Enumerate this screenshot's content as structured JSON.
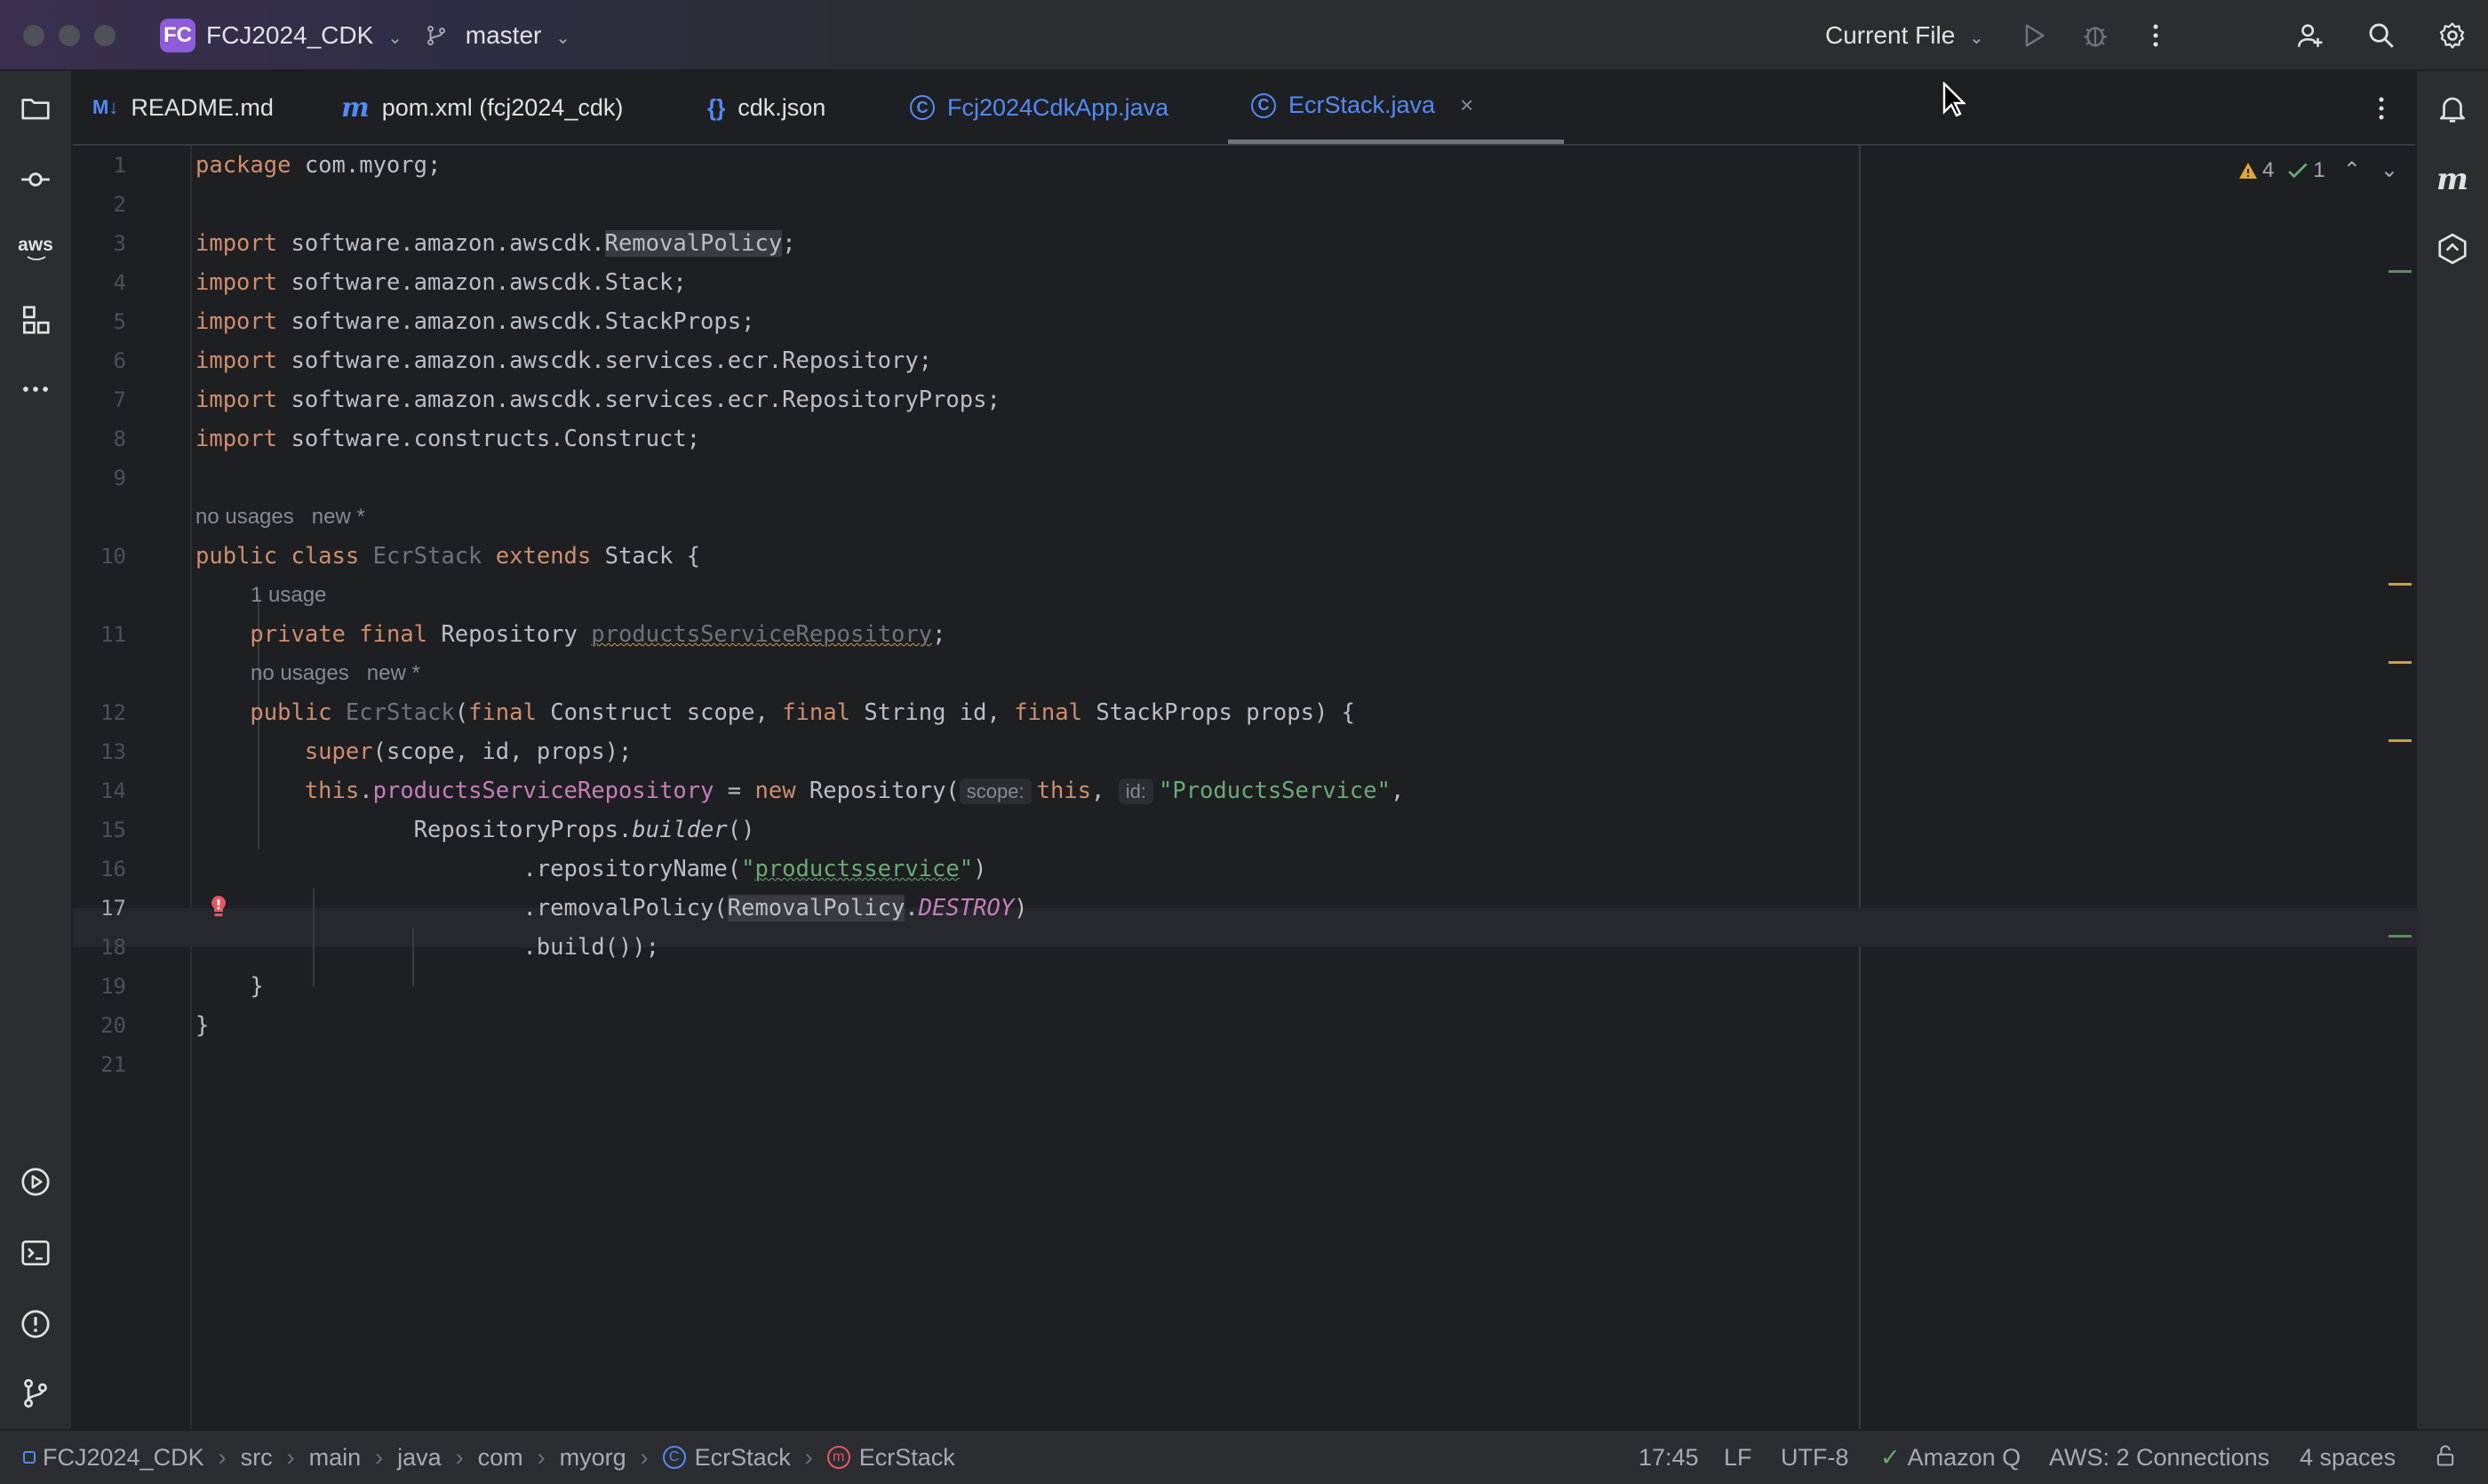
{
  "titlebar": {
    "project_badge": "FC",
    "project_name": "FCJ2024_CDK",
    "branch": "master",
    "run_config": "Current File"
  },
  "tabs": [
    {
      "icon": "M↓",
      "label": "README.md"
    },
    {
      "icon": "m",
      "label": "pom.xml (fcj2024_cdk)"
    },
    {
      "icon": "{}",
      "label": "cdk.json"
    },
    {
      "icon": "C",
      "label": "Fcj2024CdkApp.java"
    },
    {
      "icon": "C",
      "label": "EcrStack.java",
      "close": "×"
    }
  ],
  "editor": {
    "line_numbers": [
      "1",
      "2",
      "3",
      "4",
      "5",
      "6",
      "7",
      "8",
      "9",
      "10",
      "11",
      "12",
      "13",
      "14",
      "15",
      "16",
      "17",
      "18",
      "19",
      "20",
      "21"
    ],
    "current_line": "17",
    "hints": {
      "class_usage": "no usages   new *",
      "field_usage": "1 usage",
      "ctor_usage": "no usages   new *",
      "scope_param": "scope:",
      "id_param": "id:"
    },
    "inspections": {
      "warnings": "4",
      "ok": "1"
    }
  },
  "statusbar": {
    "breadcrumbs": [
      "FCJ2024_CDK",
      "src",
      "main",
      "java",
      "com",
      "myorg",
      "EcrStack",
      "EcrStack"
    ],
    "position": "17:45",
    "line_sep": "LF",
    "encoding": "UTF-8",
    "amazon_q": "Amazon Q",
    "aws": "AWS: 2 Connections",
    "indent": "4 spaces"
  },
  "colors": {
    "keyword": "#cf8e6d",
    "field": "#c77dbb",
    "string": "#6aab73",
    "accent_blue": "#548af7",
    "project_badge": "#8e5bd9"
  }
}
